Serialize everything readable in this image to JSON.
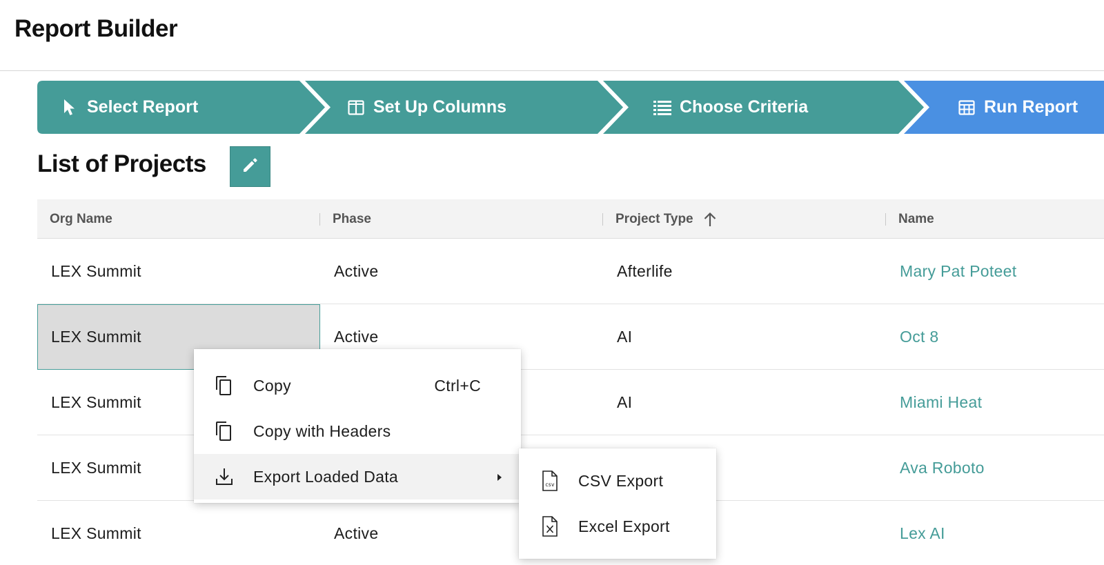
{
  "app": {
    "title": "Report Builder"
  },
  "colors": {
    "teal": "#459c98",
    "blue": "#4a90e2",
    "link": "#459c98"
  },
  "stepper": {
    "steps": [
      {
        "label": "Select Report",
        "icon": "cursor-icon",
        "state": "completed"
      },
      {
        "label": "Set Up Columns",
        "icon": "columns-icon",
        "state": "completed"
      },
      {
        "label": "Choose Criteria",
        "icon": "list-icon",
        "state": "completed"
      },
      {
        "label": "Run Report",
        "icon": "table-icon",
        "state": "active"
      }
    ]
  },
  "report": {
    "title": "List of Projects",
    "edit_icon": "pencil-icon"
  },
  "grid": {
    "columns": [
      {
        "label": "Org Name"
      },
      {
        "label": "Phase"
      },
      {
        "label": "Project Type",
        "sort": "ascending"
      },
      {
        "label": "Name"
      }
    ],
    "rows": [
      {
        "org": "LEX Summit",
        "phase": "Active",
        "type": "Afterlife",
        "name": "Mary Pat Poteet"
      },
      {
        "org": "LEX Summit",
        "phase": "Active",
        "type": "AI",
        "name": "Oct 8",
        "selected_cell": "org"
      },
      {
        "org": "LEX Summit",
        "phase": "",
        "type": "AI",
        "name": "Miami Heat"
      },
      {
        "org": "LEX Summit",
        "phase": "",
        "type": "",
        "name": "Ava Roboto"
      },
      {
        "org": "LEX Summit",
        "phase": "Active",
        "type": "",
        "name": "Lex AI"
      }
    ]
  },
  "context_menu": {
    "items": [
      {
        "label": "Copy",
        "shortcut": "Ctrl+C",
        "icon": "copy-icon"
      },
      {
        "label": "Copy with Headers",
        "icon": "copy-icon"
      },
      {
        "label": "Export Loaded Data",
        "icon": "download-icon",
        "has_submenu": true
      }
    ],
    "submenu": [
      {
        "label": "CSV Export",
        "icon": "csv-file-icon"
      },
      {
        "label": "Excel Export",
        "icon": "excel-file-icon"
      }
    ]
  }
}
